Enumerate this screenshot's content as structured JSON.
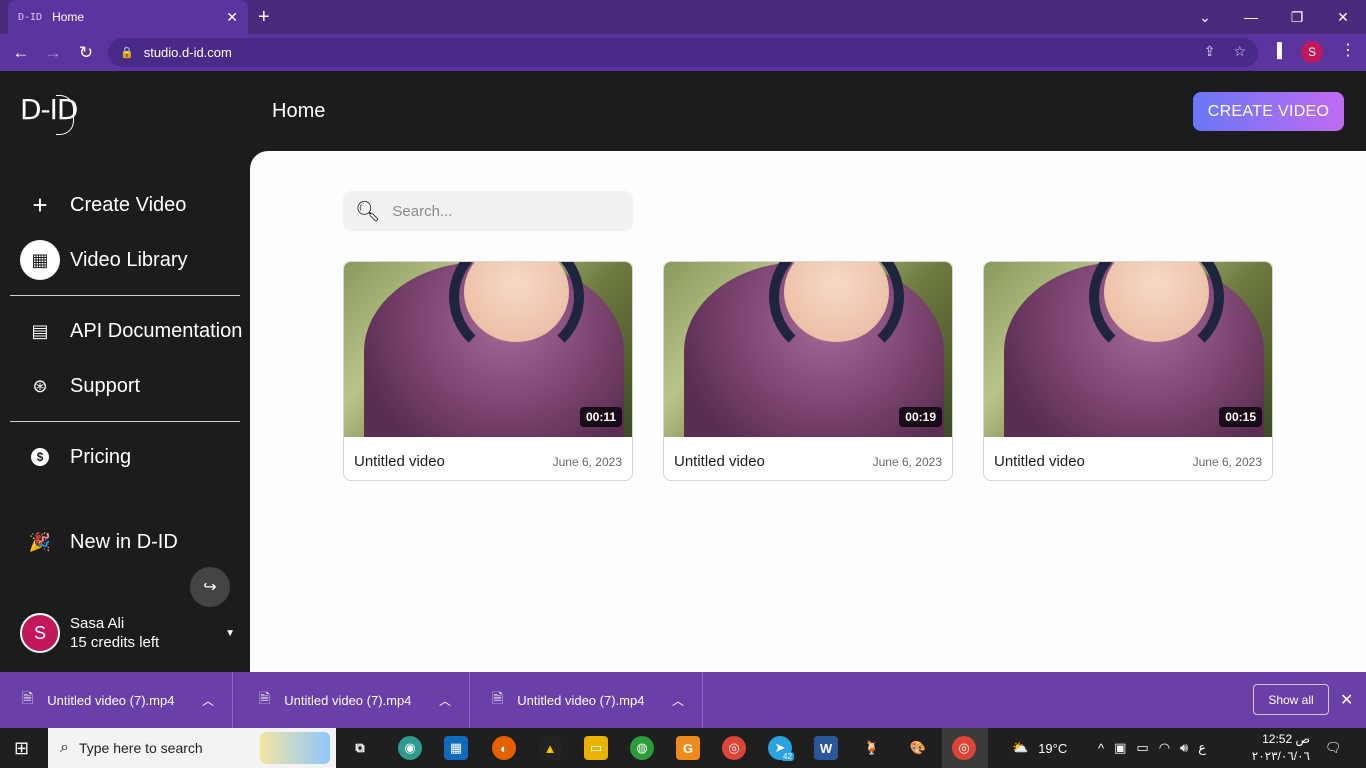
{
  "browser": {
    "tab_title": "Home",
    "tab_favicon": "D-ID",
    "url": "studio.d-id.com",
    "profile_initial": "S"
  },
  "sidebar": {
    "logo": "D-ID",
    "items": [
      {
        "label": "Create Video",
        "icon": "plus-icon"
      },
      {
        "label": "Video Library",
        "icon": "grid-icon"
      },
      {
        "label": "API Documentation",
        "icon": "document-icon"
      },
      {
        "label": "Support",
        "icon": "lifebuoy-icon"
      },
      {
        "label": "Pricing",
        "icon": "dollar-icon"
      },
      {
        "label": "New in D-ID",
        "icon": "party-popper-icon"
      }
    ],
    "user": {
      "initial": "S",
      "name": "Sasa Ali",
      "credits": "15 credits left"
    }
  },
  "header": {
    "title": "Home",
    "create_button": "CREATE VIDEO"
  },
  "search": {
    "placeholder": "Search..."
  },
  "videos": [
    {
      "title": "Untitled video",
      "date": "June 6, 2023",
      "duration": "00:11"
    },
    {
      "title": "Untitled video",
      "date": "June 6, 2023",
      "duration": "00:19"
    },
    {
      "title": "Untitled video",
      "date": "June 6, 2023",
      "duration": "00:15"
    }
  ],
  "downloads": {
    "items": [
      {
        "name": "Untitled video (7).mp4"
      },
      {
        "name": "Untitled video (7).mp4"
      },
      {
        "name": "Untitled video (7).mp4"
      }
    ],
    "show_all": "Show all"
  },
  "taskbar": {
    "search_placeholder": "Type here to search",
    "weather": "19°C",
    "time": "12:52 ص",
    "date": "٢٠٢٣/٠٦/٠٦",
    "lang": "ع",
    "telegram_badge": "42"
  },
  "colors": {
    "browser_accent": "#5b34a0",
    "app_bg": "#1c1c1e",
    "create_gradient_start": "#6a77f5",
    "create_gradient_end": "#c16af2",
    "avatar": "#c2185b"
  }
}
